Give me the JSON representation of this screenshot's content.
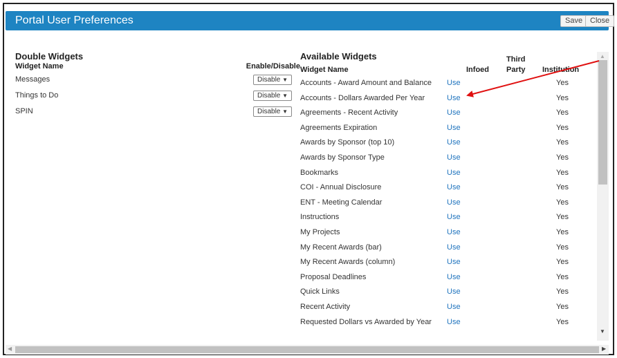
{
  "header": {
    "title": "Portal User Preferences",
    "save_label": "Save",
    "close_label": "Close"
  },
  "double_widgets": {
    "section_title": "Double Widgets",
    "col_name": "Widget Name",
    "col_enable": "Enable/Disable",
    "rows": [
      {
        "name": "Messages",
        "value": "Disable"
      },
      {
        "name": "Things to Do",
        "value": "Disable"
      },
      {
        "name": "SPIN",
        "value": "Disable"
      }
    ]
  },
  "available_widgets": {
    "section_title": "Available Widgets",
    "col_name": "Widget Name",
    "col_infoed": "Infoed",
    "col_third_line1": "Third",
    "col_third_line2": "Party",
    "col_institution": "Institution",
    "rows": [
      {
        "name": "Accounts - Award Amount and Balance",
        "action": "Use",
        "institution": "Yes"
      },
      {
        "name": "Accounts - Dollars Awarded Per Year",
        "action": "Use",
        "institution": "Yes"
      },
      {
        "name": "Agreements - Recent Activity",
        "action": "Use",
        "institution": "Yes"
      },
      {
        "name": "Agreements Expiration",
        "action": "Use",
        "institution": "Yes"
      },
      {
        "name": "Awards by Sponsor (top 10)",
        "action": "Use",
        "institution": "Yes"
      },
      {
        "name": "Awards by Sponsor Type",
        "action": "Use",
        "institution": "Yes"
      },
      {
        "name": "Bookmarks",
        "action": "Use",
        "institution": "Yes"
      },
      {
        "name": "COI - Annual Disclosure",
        "action": "Use",
        "institution": "Yes"
      },
      {
        "name": "ENT - Meeting Calendar",
        "action": "Use",
        "institution": "Yes"
      },
      {
        "name": "Instructions",
        "action": "Use",
        "institution": "Yes"
      },
      {
        "name": "My Projects",
        "action": "Use",
        "institution": "Yes"
      },
      {
        "name": "My Recent Awards (bar)",
        "action": "Use",
        "institution": "Yes"
      },
      {
        "name": "My Recent Awards (column)",
        "action": "Use",
        "institution": "Yes"
      },
      {
        "name": "Proposal Deadlines",
        "action": "Use",
        "institution": "Yes"
      },
      {
        "name": "Quick Links",
        "action": "Use",
        "institution": "Yes"
      },
      {
        "name": "Recent Activity",
        "action": "Use",
        "institution": "Yes"
      },
      {
        "name": "Requested Dollars vs Awarded by Year",
        "action": "Use",
        "institution": "Yes"
      }
    ]
  },
  "icons": {
    "dropdown_caret": "caret-down-icon",
    "scroll_up": "scroll-up-icon",
    "scroll_down": "scroll-down-icon",
    "scroll_left": "scroll-left-icon",
    "scroll_right": "scroll-right-icon",
    "annotation": "red-arrow-annotation"
  },
  "colors": {
    "titlebar": "#1e84c2",
    "link": "#1e73be",
    "annotation_arrow": "#e01010"
  }
}
